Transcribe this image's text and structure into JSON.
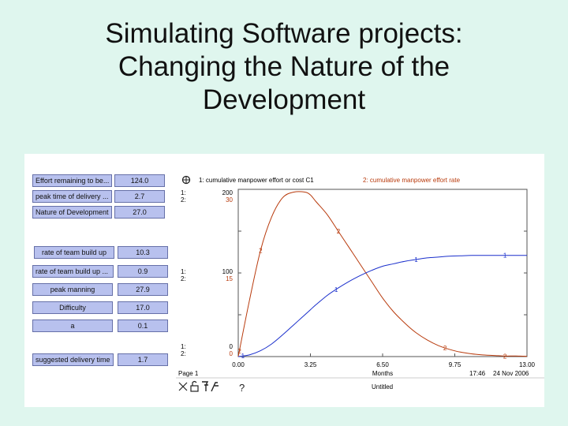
{
  "slide": {
    "title_lines": [
      "Simulating Software projects:",
      "Changing the Nature of the",
      "Development"
    ]
  },
  "variables": [
    {
      "label": "Effort remaining to be...",
      "value": "124.0",
      "align": "left"
    },
    {
      "label": "peak time of delivery ...",
      "value": "2.7",
      "align": "left"
    },
    {
      "label": "Nature of Development",
      "value": "27.0",
      "align": "left"
    },
    {
      "label": "rate of team build up",
      "value": "10.3",
      "align": "center"
    },
    {
      "label": "rate of team build up ...",
      "value": "0.9",
      "align": "left"
    },
    {
      "label": "peak manning",
      "value": "27.9",
      "align": "center"
    },
    {
      "label": "Difficulty",
      "value": "17.0",
      "align": "center"
    },
    {
      "label": "a",
      "value": "0.1",
      "align": "center"
    },
    {
      "label": "suggested delivery time",
      "value": "1.7",
      "align": "left"
    }
  ],
  "graph": {
    "legend": {
      "series1": "1: cumulative manpower effort or cost C1",
      "series2": "2: cumulative manpower effort rate"
    },
    "axis_labels": {
      "top_1": "1:",
      "top_2": "2:",
      "top_v1": "200",
      "top_v2": "30",
      "mid_1": "1:",
      "mid_2": "2:",
      "mid_v1": "100",
      "mid_v2": "15",
      "bot_1": "1:",
      "bot_2": "2:",
      "bot_v1": "0",
      "bot_v2": "0"
    },
    "x_ticks": [
      "0.00",
      "3.25",
      "6.50",
      "9.75",
      "13.00"
    ],
    "x_unit": "Months",
    "page_label": "Page 1",
    "time": "17:46",
    "date": "24 Nov 2006",
    "doc_name": "Untitled",
    "help_glyph": "?",
    "marker1": "1",
    "marker2": "2",
    "colors": {
      "series1": "#1a2fcc",
      "series2": "#b83a0c",
      "frame": "#555555"
    }
  },
  "chart_data": {
    "type": "line",
    "x": [
      0,
      0.5,
      1,
      1.5,
      2,
      2.5,
      3,
      3.25,
      3.5,
      4,
      4.5,
      5,
      5.5,
      6,
      6.5,
      7,
      7.5,
      8,
      8.5,
      9,
      9.5,
      10,
      10.5,
      11,
      11.5,
      12,
      12.5,
      13
    ],
    "series": [
      {
        "name": "1: cumulative manpower effort or cost C1",
        "values": [
          0,
          2,
          7,
          15,
          26,
          38,
          50,
          56,
          62,
          73,
          82,
          90,
          97,
          103,
          108,
          111,
          114,
          116,
          118,
          119,
          120,
          120.5,
          121,
          121,
          121,
          121,
          121,
          121
        ]
      },
      {
        "name": "2: cumulative manpower effort rate",
        "values": [
          0,
          10,
          19,
          25,
          28.5,
          29.5,
          29.5,
          29,
          27.8,
          25.5,
          22.5,
          19.5,
          16.5,
          13.5,
          10.5,
          8,
          6,
          4.3,
          3,
          2,
          1.3,
          0.8,
          0.5,
          0.3,
          0.2,
          0.1,
          0.1,
          0.05
        ]
      }
    ],
    "xlim": [
      0,
      13
    ],
    "ylim_series1": [
      0,
      200
    ],
    "ylim_series2": [
      0,
      30
    ],
    "xlabel": "Months",
    "grid": false
  }
}
